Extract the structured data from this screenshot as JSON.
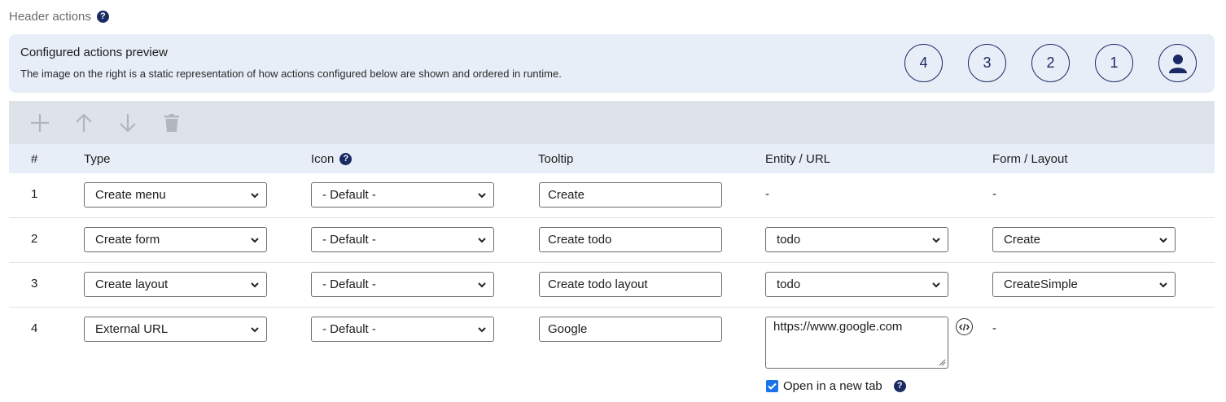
{
  "section": {
    "title": "Header actions"
  },
  "preview": {
    "title": "Configured actions preview",
    "description": "The image on the right is a static representation of how actions configured below are shown and ordered in runtime.",
    "circles": [
      "4",
      "3",
      "2",
      "1"
    ],
    "user_icon": "user-icon"
  },
  "toolbar": {
    "add_icon": "plus-icon",
    "up_icon": "arrow-up-icon",
    "down_icon": "arrow-down-icon",
    "delete_icon": "trash-icon",
    "disabled_color": "#b0b6bb"
  },
  "table": {
    "headers": {
      "num": "#",
      "type": "Type",
      "icon": "Icon",
      "tooltip": "Tooltip",
      "entity_url": "Entity / URL",
      "form_layout": "Form / Layout"
    },
    "rows": [
      {
        "num": "1",
        "type": "Create menu",
        "icon": "- Default -",
        "tooltip": "Create",
        "entity": "-",
        "form": "-"
      },
      {
        "num": "2",
        "type": "Create form",
        "icon": "- Default -",
        "tooltip": "Create todo",
        "entity": "todo",
        "form": "Create"
      },
      {
        "num": "3",
        "type": "Create layout",
        "icon": "- Default -",
        "tooltip": "Create todo layout",
        "entity": "todo",
        "form": "CreateSimple"
      },
      {
        "num": "4",
        "type": "External URL",
        "icon": "- Default -",
        "tooltip": "Google",
        "url": "https://www.google.com",
        "form": "-",
        "open_new_tab_label": "Open in a new tab",
        "open_new_tab_checked": true
      }
    ]
  },
  "colors": {
    "accent": "#1a2a64",
    "preview_bg": "#e8eef8",
    "toolbar_bg": "#dde3e8",
    "checkbox": "#1a73e8"
  }
}
